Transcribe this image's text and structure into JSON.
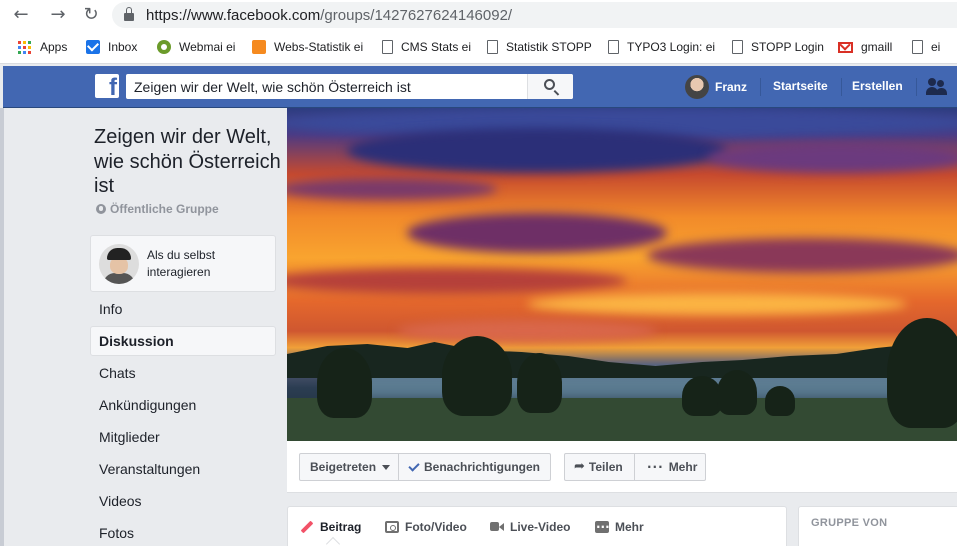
{
  "browser": {
    "url_host": "https://www.facebook.com",
    "url_path": "/groups/1427627624146092/",
    "bookmarks": [
      {
        "label": "Apps",
        "icon": "apps-grid-icon"
      },
      {
        "label": "Inbox",
        "icon": "inbox-mail-icon"
      },
      {
        "label": "Webmai ei",
        "icon": "gear-icon"
      },
      {
        "label": "Webs-Statistik ei",
        "icon": "statistics-icon"
      },
      {
        "label": "CMS Stats ei",
        "icon": "page-icon"
      },
      {
        "label": "Statistik STOPP",
        "icon": "page-icon"
      },
      {
        "label": "TYPO3 Login: ei",
        "icon": "page-icon"
      },
      {
        "label": "STOPP Login",
        "icon": "page-icon"
      },
      {
        "label": "gmaill",
        "icon": "gmail-icon"
      },
      {
        "label": "ei",
        "icon": "page-icon"
      }
    ]
  },
  "header": {
    "logo_letter": "f",
    "search_value": "Zeigen wir der Welt, wie schön Österreich ist",
    "user_name": "Franz",
    "nav": [
      "Startseite",
      "Erstellen"
    ],
    "brand_color": "#4267b2"
  },
  "sidebar": {
    "group_title": "Zeigen wir der Welt, wie schön Österreich ist",
    "group_type": "Öffentliche Gruppe",
    "self_interact": "Als du selbst interagieren",
    "items": [
      "Info",
      "Diskussion",
      "Chats",
      "Ankündigungen",
      "Mitglieder",
      "Veranstaltungen",
      "Videos",
      "Fotos"
    ],
    "active_item": "Diskussion"
  },
  "actions": {
    "joined": "Beigetreten",
    "notifications": "Benachrichtigungen",
    "share": "Teilen",
    "more": "Mehr"
  },
  "composer": {
    "tabs": [
      "Beitrag",
      "Foto/Video",
      "Live-Video",
      "Mehr"
    ]
  },
  "right_column": {
    "group_by": "GRUPPE VON"
  }
}
